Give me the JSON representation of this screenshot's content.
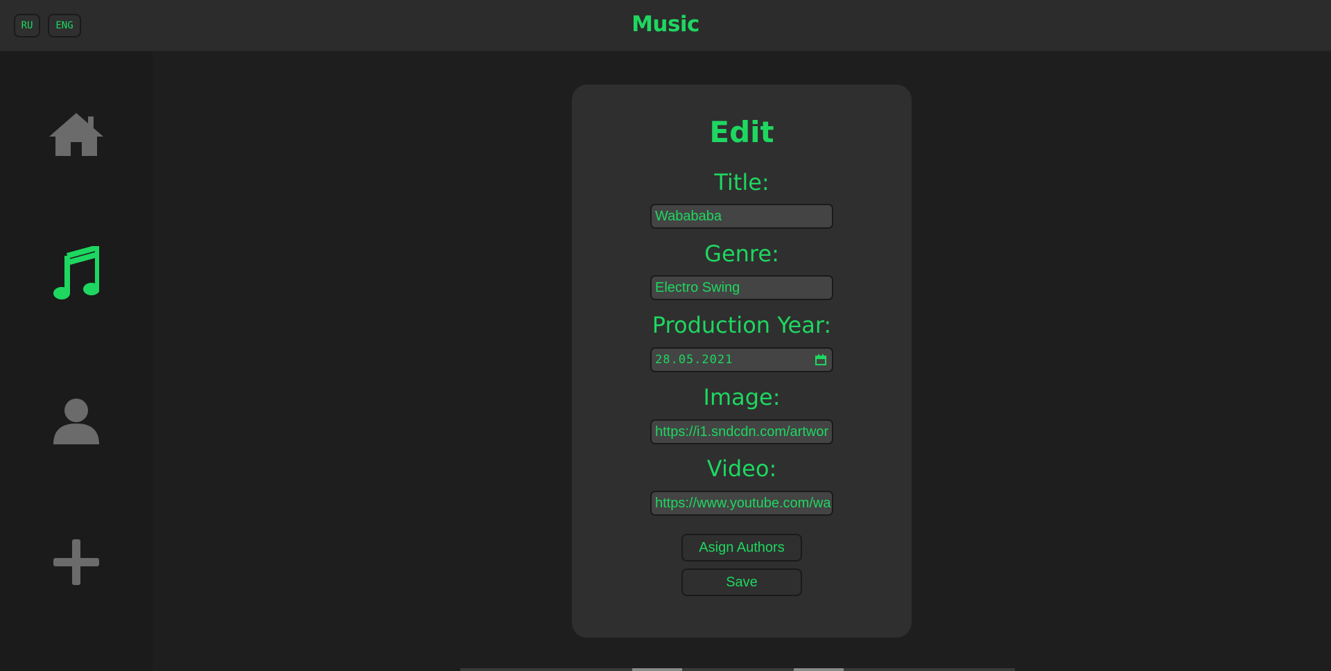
{
  "header": {
    "title": "Music",
    "lang_buttons": {
      "ru": "RU",
      "eng": "ENG"
    }
  },
  "sidebar": {
    "items": [
      {
        "icon": "home-icon",
        "active": false
      },
      {
        "icon": "music-note-icon",
        "active": true
      },
      {
        "icon": "user-icon",
        "active": false
      },
      {
        "icon": "plus-icon",
        "active": false
      }
    ]
  },
  "form": {
    "heading": "Edit",
    "title_label": "Title:",
    "title_value": "Wabababa",
    "genre_label": "Genre:",
    "genre_value": "Electro Swing",
    "year_label": "Production Year:",
    "year_value": "28.05.2021",
    "image_label": "Image:",
    "image_value": "https://i1.sndcdn.com/artwor",
    "video_label": "Video:",
    "video_value": "https://www.youtube.com/wa",
    "assign_button": "Asign Authors",
    "save_button": "Save"
  },
  "colors": {
    "accent": "#1ed760",
    "icon_inactive": "#6b6b6b",
    "background": "#1e1e1e",
    "card": "#2f2f2f",
    "input": "#444444"
  }
}
